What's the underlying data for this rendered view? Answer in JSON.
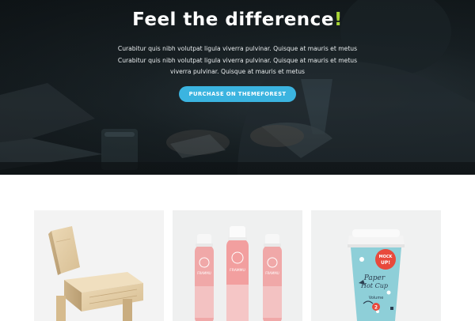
{
  "hero": {
    "title_main": "Feel the difference",
    "title_accent": "!",
    "description_lines": [
      "Curabitur quis nibh volutpat ligula viverra pulvinar. Quisque at mauris et metus",
      "Curabitur quis nibh volutpat ligula viverra pulvinar. Quisque at mauris et metus",
      "viverra pulvinar. Quisque at mauris et metus"
    ],
    "cta_label": "PURCHASE ON THEMEFOREST"
  },
  "gallery": {
    "items": [
      {
        "subject": "wooden chair"
      },
      {
        "subject": "juice bottles",
        "bottle_label": "FRAMMU"
      },
      {
        "subject": "paper cup",
        "badge_top": "MOCK",
        "badge_bottom": "UP!",
        "cup_line_1": "Paper",
        "cup_line_2": "Hot Cup",
        "cup_line_3": "Volume",
        "cup_number": "2"
      }
    ]
  },
  "colors": {
    "accent_green": "#a8d436",
    "cta_blue": "#3bb4e0",
    "hero_dark": "#1b2428",
    "cup_red": "#e8493c"
  }
}
